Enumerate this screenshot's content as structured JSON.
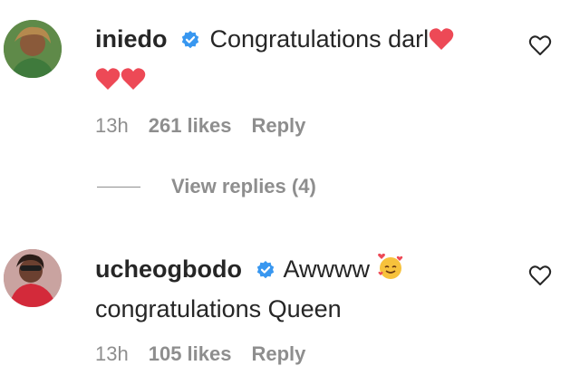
{
  "comments": [
    {
      "username": "iniedo",
      "verified": true,
      "text": "Congratulations darl",
      "emoji": "❤️❤️❤️",
      "time": "13h",
      "likes": "261 likes",
      "reply": "Reply"
    },
    {
      "username": "ucheogbodo",
      "verified": true,
      "text_line1": "Awwww",
      "emoji": "🥰",
      "text_line2": "congratulations Queen",
      "time": "13h",
      "likes": "105 likes",
      "reply": "Reply"
    }
  ],
  "view_replies": "View replies (4)",
  "colors": {
    "verified": "#3897f0",
    "heart": "#ed4956",
    "muted": "#8e8e8e",
    "text": "#262626"
  },
  "icons": {
    "verified": "verified-badge-icon",
    "like": "heart-outline-icon"
  }
}
